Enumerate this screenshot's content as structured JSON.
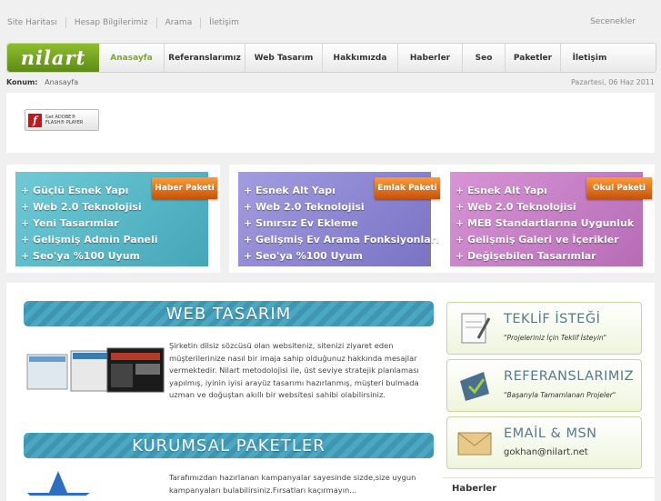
{
  "top_links": [
    "Site Haritası",
    "Hesap Bilgilerimiz",
    "Arama",
    "İletişim"
  ],
  "options_label": "Secenekler",
  "logo_text": "nilart",
  "nav": [
    "Anasayfa",
    "Referanslarımız",
    "Web Tasarım",
    "Hakkımızda",
    "Haberler",
    "Seo",
    "Paketler",
    "İletişim"
  ],
  "breadcrumb": {
    "label": "Konum:",
    "value": "Anasayfa"
  },
  "date": "Pazartesi, 06 Haz 2011",
  "flash": {
    "line1": "Get ADOBE®",
    "line2": "FLASH® PLAYER",
    "letter": "f"
  },
  "promos": [
    {
      "tag": "Haber Paketi",
      "items": [
        "+ Güçlü Esnek Yapı",
        "+ Web 2.0 Teknolojisi",
        "+ Yeni Tasarımlar",
        "+ Gelişmiş Admin Paneli",
        "+ Seo'ya %100 Uyum"
      ]
    },
    {
      "tag": "Emlak Paketi",
      "items": [
        "+ Esnek Alt Yapı",
        "+ Web 2.0 Teknolojisi",
        "+ Sınırsız Ev Ekleme",
        "+ Gelişmiş Ev Arama Fonksiyonları",
        "+ Seo'ya %100 Uyum"
      ]
    },
    {
      "tag": "Okul Paketi",
      "items": [
        "+ Esnek Alt Yapı",
        "+ Web 2.0 Teknolojisi",
        "+ MEB Standartlarına Uygunluk",
        "+ Gelişmiş  Galeri ve İçerikler",
        "+ Değişebilen Tasarımlar"
      ]
    }
  ],
  "colors": {
    "promo1": "#5bbac8",
    "promo2": "#8c86d0",
    "promo3": "#c57fc6",
    "accent": "#7bab1f",
    "tag": "#e06a14"
  },
  "sections": [
    {
      "title": "WEB TASARIM",
      "text": "Şirketin dilsiz sözcüsü olan websiteniz, sitenizi ziyaret eden müşterilerinize nasıl bir imaja sahip olduğunuz hakkında mesajlar vermektedir. Nilart metodolojisi ile, üst seviye stratejik planlaması yapılmış, iyinin iyisi arayüz tasarımı hazırlanmış, müşteri bulmada uzman ve doğuştan akıllı bir websitesi sahibi olabilirsiniz."
    },
    {
      "title": "KURUMSAL PAKETLER",
      "text": "Tarafımızdan hazırlanan kampanyalar sayesinde sizde,size uygun kampanyaları bulabilirsiniz.Fırsatları kaçırmayın..."
    }
  ],
  "side_buttons": [
    {
      "title": "TEKLİF İSTEĞİ",
      "subtitle": "\"Projeleriniz İçin Teklif İsteyin\"",
      "icon": "document-pen-icon"
    },
    {
      "title": "REFERANSLARIMIZ",
      "subtitle": "\"Başarıyla Tamamlanan Projeler\"",
      "icon": "folder-check-icon"
    },
    {
      "title": "EMAİL & MSN",
      "subtitle": "gokhan@nilart.net",
      "icon": "envelope-icon"
    }
  ],
  "news_title": "Haberler"
}
